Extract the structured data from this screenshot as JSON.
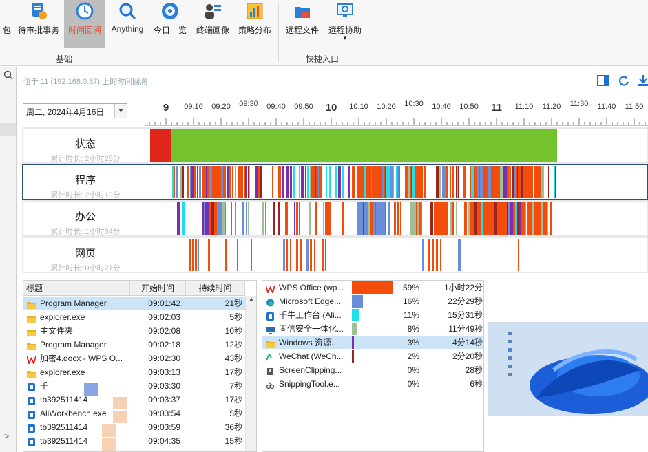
{
  "ribbon": {
    "items": [
      {
        "label": "包",
        "icon": "package-icon"
      },
      {
        "label": "待审批事务",
        "icon": "pending-approval-icon"
      },
      {
        "label": "时间回溯",
        "icon": "time-review-icon"
      },
      {
        "label": "Anything",
        "icon": "anything-search-icon"
      },
      {
        "label": "今日一览",
        "icon": "today-overview-icon"
      },
      {
        "label": "终端画像",
        "icon": "terminal-profile-icon"
      },
      {
        "label": "策略分布",
        "icon": "policy-distribution-icon"
      },
      {
        "label": "远程文件",
        "icon": "remote-file-icon"
      },
      {
        "label": "远程协助",
        "icon": "remote-assist-icon"
      }
    ],
    "groups": [
      "基础",
      "快捷入口"
    ]
  },
  "info_line": "位于 11 (192.168.0.87) 上的时间回溯",
  "date": "周二, 2024年4月16日",
  "timeline": {
    "hour_labels": [
      "9",
      "10",
      "11"
    ],
    "minute_labels": [
      "09:10",
      "09:20",
      "09:30",
      "09:40",
      "09:50",
      "10:10",
      "10:20",
      "10:30",
      "10:40",
      "10:50",
      "11:10",
      "11:20",
      "11:30",
      "11:40",
      "11:50"
    ],
    "rows": [
      {
        "title": "状态",
        "subtitle": "累计时长: 2小时28分"
      },
      {
        "title": "程序",
        "subtitle": "累计时长: 2小时19分"
      },
      {
        "title": "办公",
        "subtitle": "累计时长: 1小时34分"
      },
      {
        "title": "网页",
        "subtitle": "累计时长: 0小时21分"
      }
    ]
  },
  "task_list": {
    "headers": [
      "标题",
      "开始时间",
      "持续时间"
    ],
    "rows": [
      {
        "title": "Program Manager",
        "start": "09:01:42",
        "duration": "21秒",
        "icon": "folder-icon",
        "selected": true
      },
      {
        "title": "explorer.exe",
        "start": "09:02:03",
        "duration": "5秒",
        "icon": "folder-icon"
      },
      {
        "title": "主文件夹",
        "start": "09:02:08",
        "duration": "10秒",
        "icon": "folder-icon"
      },
      {
        "title": "Program Manager",
        "start": "09:02:18",
        "duration": "12秒",
        "icon": "folder-icon"
      },
      {
        "title": "加密4.docx - WPS O...",
        "start": "09:02:30",
        "duration": "43秒",
        "icon": "wps-icon"
      },
      {
        "title": "explorer.exe",
        "start": "09:03:13",
        "duration": "17秒",
        "icon": "folder-icon"
      },
      {
        "title": "千",
        "start": "09:03:30",
        "duration": "7秒",
        "icon": "app-blue-icon"
      },
      {
        "title": "tb392511414",
        "start": "09:03:37",
        "duration": "17秒",
        "icon": "app-blue-icon"
      },
      {
        "title": "AliWorkbench.exe",
        "start": "09:03:54",
        "duration": "5秒",
        "icon": "app-blue-icon"
      },
      {
        "title": "tb392511414",
        "start": "09:03:59",
        "duration": "36秒",
        "icon": "app-blue-icon"
      },
      {
        "title": "tb392511414",
        "start": "09:04:35",
        "duration": "15秒",
        "icon": "app-blue-icon"
      }
    ]
  },
  "app_stats": [
    {
      "name": "WPS Office (wp...",
      "percent": "59%",
      "duration": "1小时22分",
      "color": "#f24d0c",
      "share": 0.59,
      "icon": "wps-icon"
    },
    {
      "name": "Microsoft Edge...",
      "percent": "16%",
      "duration": "22分29秒",
      "color": "#6a8fd8",
      "share": 0.16,
      "icon": "edge-icon"
    },
    {
      "name": "千牛工作台 (Ali...",
      "percent": "11%",
      "duration": "15分31秒",
      "color": "#1de0ea",
      "share": 0.11,
      "icon": "app-blue-icon"
    },
    {
      "name": "固信安全一体化...",
      "percent": "8%",
      "duration": "11分49秒",
      "color": "#9dbf9a",
      "share": 0.08,
      "icon": "monitor-icon"
    },
    {
      "name": "Windows 资源...",
      "percent": "3%",
      "duration": "4分14秒",
      "color": "#7a2eb0",
      "share": 0.03,
      "icon": "folder-icon",
      "selected": true
    },
    {
      "name": "WeChat (WeCh...",
      "percent": "2%",
      "duration": "2分20秒",
      "color": "#9a2420",
      "share": 0.02,
      "icon": "wechat-icon"
    },
    {
      "name": "ScreenClipping...",
      "percent": "0%",
      "duration": "28秒",
      "color": "#888888",
      "share": 0.0,
      "icon": "clip-icon"
    },
    {
      "name": "SnippingTool.e...",
      "percent": "0%",
      "duration": "6秒",
      "color": "#888888",
      "share": 0.0,
      "icon": "snip-icon"
    }
  ]
}
